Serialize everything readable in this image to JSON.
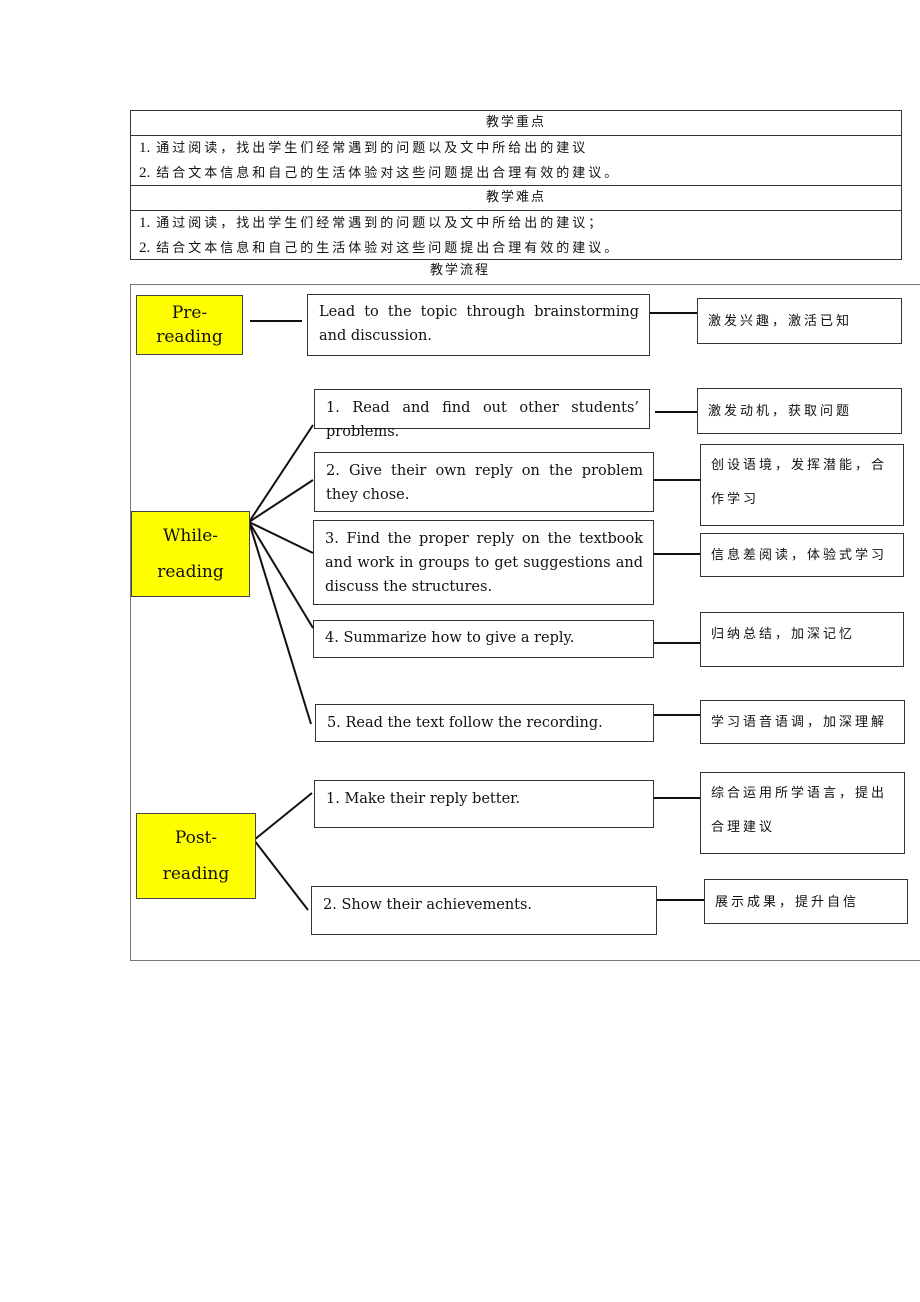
{
  "table": {
    "focus_header": "教学重点",
    "focus_items": [
      {
        "num": "1.",
        "text": "通过阅读，找出学生们经常遇到的问题以及文中所给出的建议"
      },
      {
        "num": "2.",
        "text": "结合文本信息和自己的生活体验对这些问题提出合理有效的建议。"
      }
    ],
    "difficulty_header": "教学难点",
    "difficulty_items": [
      {
        "num": "1.",
        "text": "通过阅读，找出学生们经常遇到的问题以及文中所给出的建议；"
      },
      {
        "num": "2.",
        "text": "结合文本信息和自己的生活体验对这些问题提出合理有效的建议。"
      }
    ]
  },
  "flow": {
    "title": "教学流程",
    "stage_color": "#ffff00",
    "stages": [
      {
        "line1": "Pre-",
        "line2": "reading",
        "steps": [
          {
            "text": "Lead to the topic through brainstorming and discussion.",
            "goal": "激发兴趣，激活已知"
          }
        ]
      },
      {
        "line1": "While-",
        "line2": "reading",
        "steps": [
          {
            "text": "1. Read and find out other students’ problems.",
            "goal": "激发动机，获取问题"
          },
          {
            "text": "2. Give their own reply on the problem they chose.",
            "goal": "创设语境，发挥潜能，合作学习"
          },
          {
            "text": "3. Find the proper reply on the textbook and work in groups to get suggestions and discuss the structures.",
            "goal": "信息差阅读，体验式学习"
          },
          {
            "text": "4. Summarize how to give a reply.",
            "goal": "归纳总结，加深记忆"
          },
          {
            "text": "5. Read the text follow the recording.",
            "goal": "学习语音语调，加深理解"
          }
        ]
      },
      {
        "line1": "Post-",
        "line2": "reading",
        "steps": [
          {
            "text": "1. Make their reply better.",
            "goal": "综合运用所学语言，提出合理建议"
          },
          {
            "text": "2. Show their achievements.",
            "goal": "展示成果，提升自信"
          }
        ]
      }
    ]
  }
}
